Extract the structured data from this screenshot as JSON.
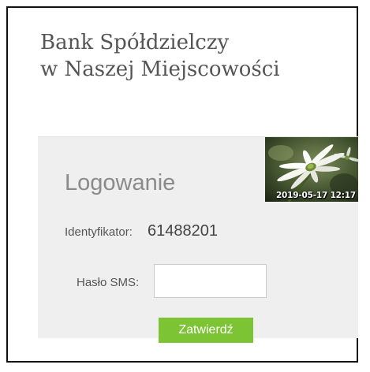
{
  "bank": {
    "name_line1": "Bank Spółdzielczy",
    "name_line2": "w Naszej Miejscowości"
  },
  "login": {
    "title": "Logowanie",
    "identifier_label": "Identyfikator:",
    "identifier_value": "61488201",
    "sms_label": "Hasło SMS:",
    "sms_value": "",
    "submit_label": "Zatwierdź"
  },
  "photo": {
    "timestamp": "2019-05-17 12:17",
    "icon": "daisy-flower-photo"
  },
  "colors": {
    "accent": "#7cc434",
    "panel_bg": "#efefef",
    "heading_text": "#555555"
  }
}
